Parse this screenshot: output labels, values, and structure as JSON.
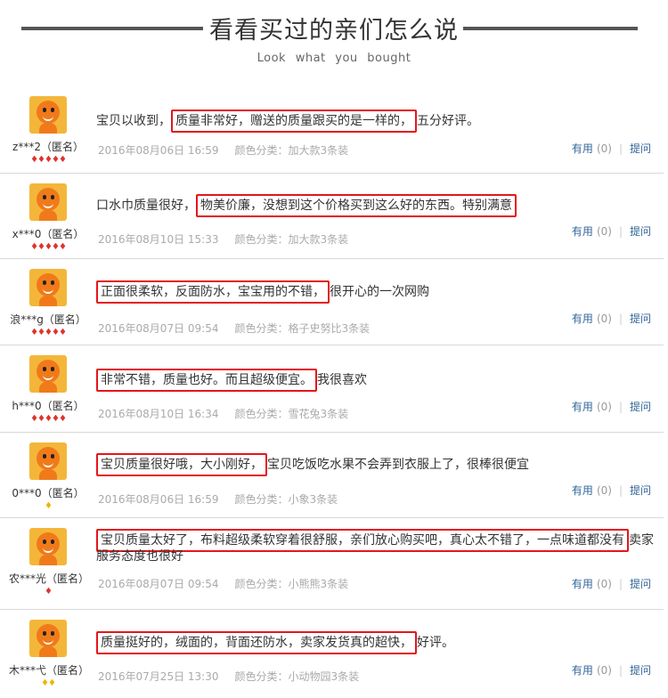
{
  "header": {
    "title": "看看买过的亲们怎么说",
    "subtitle": "Look what you bought"
  },
  "reviews": [
    {
      "user": "z***2（匿名）",
      "level": "♦♦♦♦♦",
      "pre": "宝贝以收到，",
      "hl": "质量非常好，赠送的质量跟买的是一样的，",
      "post": "五分好评。",
      "date": "2016年08月06日 16:59",
      "spec": "颜色分类：加大款3条装",
      "useful": "有用",
      "count": "(0)",
      "ask": "提问"
    },
    {
      "user": "x***0（匿名）",
      "level": "♦♦♦♦♦",
      "pre": "口水巾质量很好，",
      "hl": "物美价廉，没想到这个价格买到这么好的东西。特别满意",
      "post": "",
      "date": "2016年08月10日 15:33",
      "spec": "颜色分类：加大款3条装",
      "useful": "有用",
      "count": "(0)",
      "ask": "提问"
    },
    {
      "user": "浪***g（匿名）",
      "level": "♦♦♦♦♦",
      "pre": "",
      "hl": "正面很柔软，反面防水，宝宝用的不错，",
      "post": "很开心的一次网购",
      "date": "2016年08月07日 09:54",
      "spec": "颜色分类：格子史努比3条装",
      "useful": "有用",
      "count": "(0)",
      "ask": "提问"
    },
    {
      "user": "h***0（匿名）",
      "level": "♦♦♦♦♦",
      "pre": "",
      "hl": "非常不错，质量也好。而且超级便宜。",
      "post": "我很喜欢",
      "date": "2016年08月10日 16:34",
      "spec": "颜色分类：雪花兔3条装",
      "useful": "有用",
      "count": "(0)",
      "ask": "提问"
    },
    {
      "user": "0***0（匿名）",
      "level": "♦",
      "pre": "",
      "hl": "宝贝质量很好哦，大小刚好，",
      "post": "宝贝吃饭吃水果不会弄到衣服上了，很棒很便宜",
      "date": "2016年08月06日 16:59",
      "spec": "颜色分类：小象3条装",
      "useful": "有用",
      "count": "(0)",
      "ask": "提问"
    },
    {
      "user": "农***光（匿名）",
      "level": "♦",
      "pre": "",
      "hl": "宝贝质量太好了，布料超级柔软穿着很舒服，亲们放心购买吧，真心太不错了，一点味道都没有",
      "post": "卖家服务态度也很好",
      "date": "2016年08月07日 09:54",
      "spec": "颜色分类：小熊熊3条装",
      "useful": "有用",
      "count": "(0)",
      "ask": "提问"
    },
    {
      "user": "木***弋（匿名）",
      "level": "♦♦",
      "pre": "",
      "hl": "质量挺好的，绒面的，背面还防水，卖家发货真的超快，",
      "post": "好评。",
      "date": "2016年07月25日 13:30",
      "spec": "颜色分类：小动物园3条装",
      "useful": "有用",
      "count": "(0)",
      "ask": "提问"
    }
  ]
}
